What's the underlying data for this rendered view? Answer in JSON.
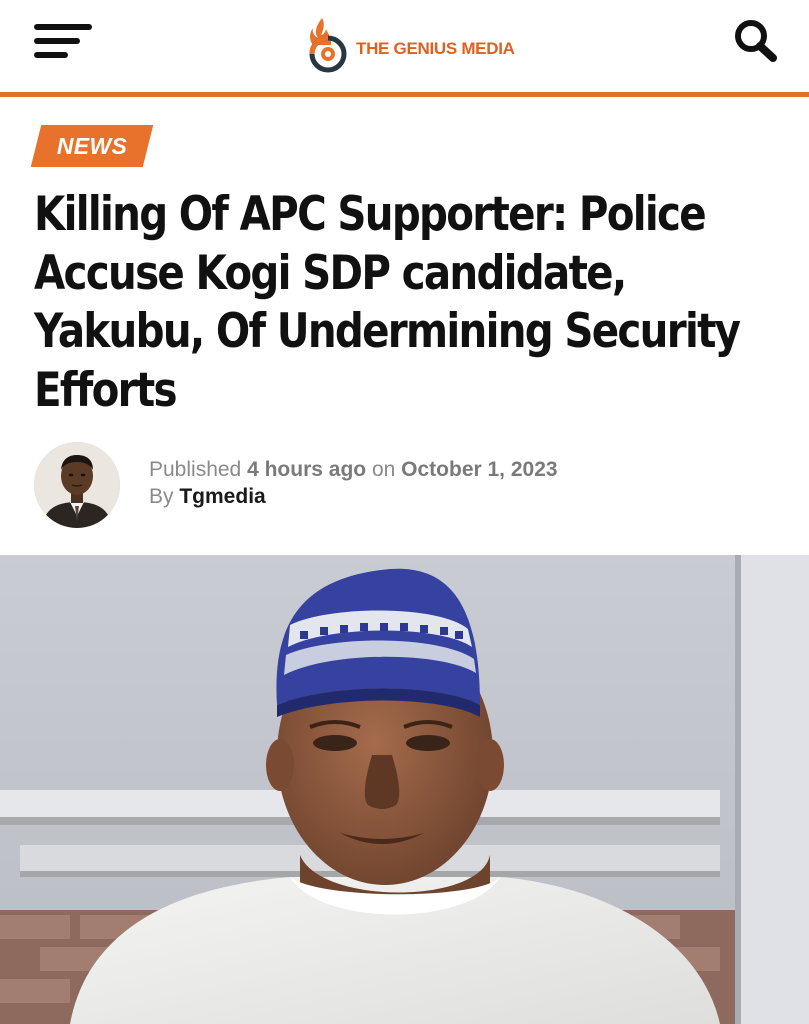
{
  "header": {
    "site_name": "THE GENIUS MEDIA",
    "menu_icon": "hamburger-menu-icon",
    "search_icon": "search-icon",
    "brand_color": "#e0611f",
    "rule_color": "#e0732a"
  },
  "article": {
    "category": "NEWS",
    "title": "Killing Of APC Supporter: Police Accuse Kogi SDP candidate, Yakubu, Of Undermining Security Efforts",
    "meta": {
      "published_label": "Published",
      "relative_time": "4 hours ago",
      "on_label": "on",
      "date": "October 1, 2023",
      "by_label": "By",
      "author": "Tgmedia"
    }
  },
  "colors": {
    "accent": "#e8722b",
    "headline": "#111111",
    "meta_text": "#8a8a8a"
  }
}
